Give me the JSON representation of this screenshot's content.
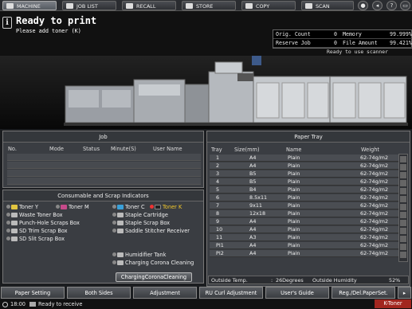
{
  "tabs": [
    {
      "label": "MACHINE"
    },
    {
      "label": "JOB LIST"
    },
    {
      "label": "RECALL"
    },
    {
      "label": "STORE"
    },
    {
      "label": "COPY"
    },
    {
      "label": "SCAN"
    }
  ],
  "status": {
    "title": "Ready to print",
    "subtitle": "Please add toner (K)"
  },
  "counts": {
    "orig_label": "Orig. Count",
    "orig_value": "0",
    "memory_label": "Memory",
    "memory_value": "99.999%",
    "reserve_label": "Reserve Job",
    "reserve_value": "0",
    "file_label": "File Amount",
    "file_value": "99.421%"
  },
  "scanner_status": "Ready to use scanner",
  "job": {
    "title": "Job",
    "headers": {
      "no": "No.",
      "mode": "Mode",
      "status": "Status",
      "minute": "Minute(S)",
      "user": "User Name"
    }
  },
  "consumables": {
    "title": "Consumable and Scrap Indicators",
    "toner_y": "Toner Y",
    "toner_m": "Toner M",
    "toner_c": "Toner C",
    "toner_k": "Toner K",
    "waste": "Waste Toner Box",
    "punch": "Punch-Hole Scraps Box",
    "sdtrim": "SD Trim Scrap Box",
    "sdslit": "SD Slit Scrap Box",
    "staple_cart": "Staple Cartridge",
    "staple_scrap": "Staple Scrap Box",
    "saddle": "Saddle Stitcher Receiver",
    "humid": "Humidifier Tank",
    "charging": "Charging Corona Cleaning",
    "clean_button": "ChargingCoronaCleaning"
  },
  "paper": {
    "title": "Paper Tray",
    "headers": {
      "tray": "Tray",
      "size": "Size(mm)",
      "name": "Name",
      "weight": "Weight"
    },
    "rows": [
      {
        "tray": "1",
        "size": "A4",
        "name": "Plain",
        "weight": "62-74g/m2"
      },
      {
        "tray": "2",
        "size": "A4",
        "name": "Plain",
        "weight": "62-74g/m2"
      },
      {
        "tray": "3",
        "size": "B5",
        "name": "Plain",
        "weight": "62-74g/m2"
      },
      {
        "tray": "4",
        "size": "B5",
        "name": "Plain",
        "weight": "62-74g/m2"
      },
      {
        "tray": "5",
        "size": "B4",
        "name": "Plain",
        "weight": "62-74g/m2"
      },
      {
        "tray": "6",
        "size": "8.5x11",
        "name": "Plain",
        "weight": "62-74g/m2"
      },
      {
        "tray": "7",
        "size": "9x11",
        "name": "Plain",
        "weight": "62-74g/m2"
      },
      {
        "tray": "8",
        "size": "12x18",
        "name": "Plain",
        "weight": "62-74g/m2"
      },
      {
        "tray": "9",
        "size": "A4",
        "name": "Plain",
        "weight": "62-74g/m2"
      },
      {
        "tray": "10",
        "size": "A4",
        "name": "Plain",
        "weight": "62-74g/m2"
      },
      {
        "tray": "11",
        "size": "A3",
        "name": "Plain",
        "weight": "62-74g/m2"
      },
      {
        "tray": "PI1",
        "size": "A4",
        "name": "Plain",
        "weight": "62-74g/m2"
      },
      {
        "tray": "PI2",
        "size": "A4",
        "name": "Plain",
        "weight": "62-74g/m2"
      }
    ],
    "outside_temp_label": "Outside Temp.",
    "outside_temp_value": "26Degrees",
    "outside_hum_label": "Outside Humidity",
    "outside_hum_value": "52%"
  },
  "bottom_buttons": [
    {
      "label": "Paper Setting"
    },
    {
      "label": "Both Sides"
    },
    {
      "label": "Adjustment"
    },
    {
      "label": "RU Curl Adjustment"
    },
    {
      "label": "User's Guide"
    },
    {
      "label": "Reg./Del.PaperSet."
    }
  ],
  "footer": {
    "time": "18:00",
    "status": "Ready to receive",
    "toner_alert": "K-Toner"
  },
  "colors": {
    "accent_red": "#a2261f",
    "toner_k_text": "#f3c82b"
  }
}
